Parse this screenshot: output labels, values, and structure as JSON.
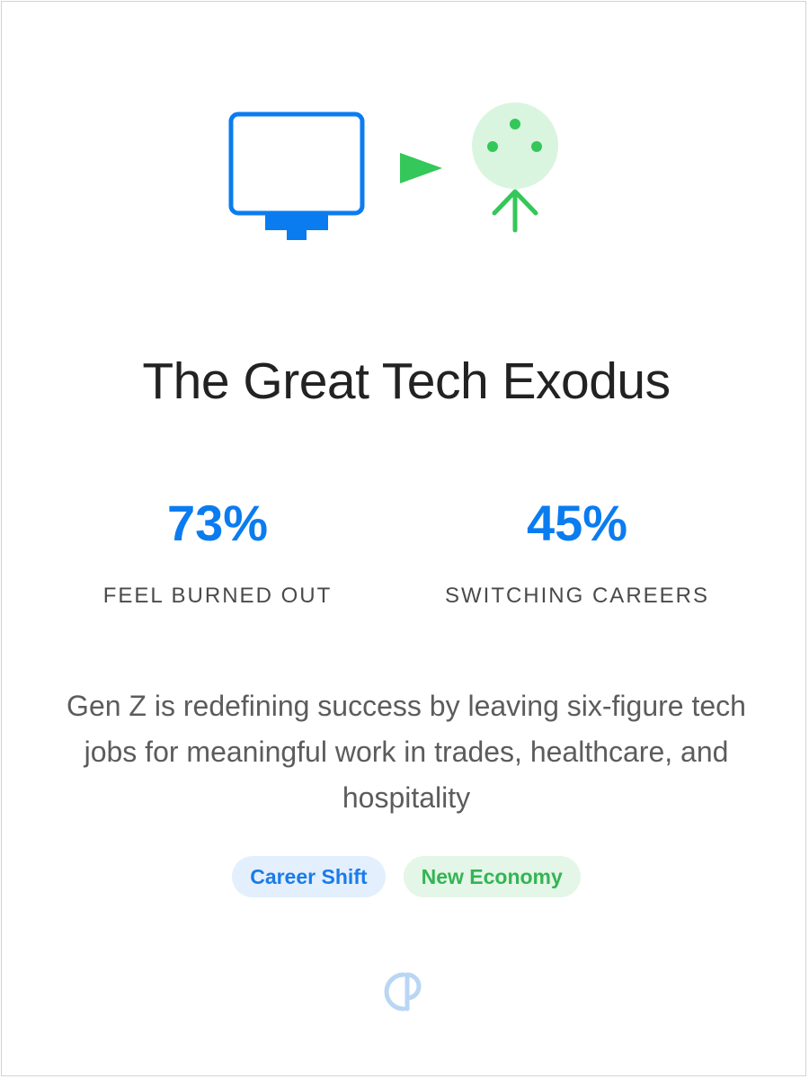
{
  "card": {
    "title": "The Great Tech Exodus",
    "stats": [
      {
        "value": "73%",
        "label": "FEEL BURNED OUT"
      },
      {
        "value": "45%",
        "label": "SWITCHING CAREERS"
      }
    ],
    "description": "Gen Z is redefining success by leaving six-figure tech jobs for meaningful work in trades, healthcare, and hospitality",
    "tags": [
      {
        "label": "Career Shift"
      },
      {
        "label": "New Economy"
      }
    ]
  },
  "icons": {
    "hero": [
      "monitor-icon",
      "arrow-right-icon",
      "growth-person-icon"
    ],
    "footer": "brand-logo-icon"
  },
  "colors": {
    "primary_blue": "#0b7cf0",
    "accent_green": "#34c759",
    "light_green": "#d9f5df",
    "light_blue": "#e3effd",
    "logo_blue": "#b9d6f4"
  }
}
